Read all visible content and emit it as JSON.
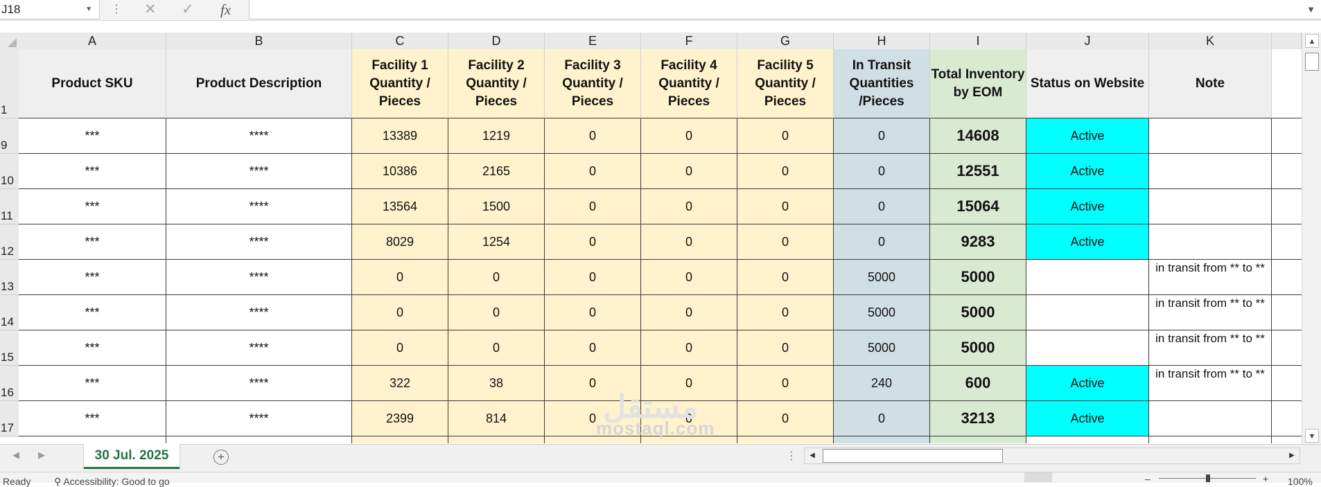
{
  "formula_bar": {
    "name_box": "J18",
    "cancel_icon": "✕",
    "enter_icon": "✓",
    "fx_label": "fx",
    "formula_value": ""
  },
  "columns": [
    "A",
    "B",
    "C",
    "D",
    "E",
    "F",
    "G",
    "H",
    "I",
    "J",
    "K"
  ],
  "header_row": {
    "row_number": "1",
    "cells": [
      "Product SKU",
      "Product Description",
      "Facility 1 Quantity / Pieces",
      "Facility 2 Quantity / Pieces",
      "Facility 3 Quantity / Pieces",
      "Facility 4 Quantity / Pieces",
      "Facility 5 Quantity / Pieces",
      "In Transit Quantities /Pieces",
      "Total Inventory by EOM",
      "Status on Website",
      "Note"
    ]
  },
  "rows": [
    {
      "row": "9",
      "cells": [
        "***",
        "****",
        "13389",
        "1219",
        "0",
        "0",
        "0",
        "0",
        "14608",
        "Active",
        ""
      ]
    },
    {
      "row": "10",
      "cells": [
        "***",
        "****",
        "10386",
        "2165",
        "0",
        "0",
        "0",
        "0",
        "12551",
        "Active",
        ""
      ]
    },
    {
      "row": "11",
      "cells": [
        "***",
        "****",
        "13564",
        "1500",
        "0",
        "0",
        "0",
        "0",
        "15064",
        "Active",
        ""
      ]
    },
    {
      "row": "12",
      "cells": [
        "***",
        "****",
        "8029",
        "1254",
        "0",
        "0",
        "0",
        "0",
        "9283",
        "Active",
        ""
      ]
    },
    {
      "row": "13",
      "cells": [
        "***",
        "****",
        "0",
        "0",
        "0",
        "0",
        "0",
        "5000",
        "5000",
        "",
        "in transit from ** to **"
      ]
    },
    {
      "row": "14",
      "cells": [
        "***",
        "****",
        "0",
        "0",
        "0",
        "0",
        "0",
        "5000",
        "5000",
        "",
        "in transit from ** to **"
      ]
    },
    {
      "row": "15",
      "cells": [
        "***",
        "****",
        "0",
        "0",
        "0",
        "0",
        "0",
        "5000",
        "5000",
        "",
        "in transit from ** to **"
      ]
    },
    {
      "row": "16",
      "cells": [
        "***",
        "****",
        "322",
        "38",
        "0",
        "0",
        "0",
        "240",
        "600",
        "Active",
        "in transit from ** to **"
      ]
    },
    {
      "row": "17",
      "cells": [
        "***",
        "****",
        "2399",
        "814",
        "0",
        "0",
        "0",
        "0",
        "3213",
        "Active",
        ""
      ]
    }
  ],
  "colors": {
    "facility_fill": "#fff2cc",
    "transit_fill": "#d0dfe3",
    "total_fill": "#d9ead3",
    "status_active_fill": "#00ffff",
    "header_gray_fill": "#efefef",
    "sheet_tab_green": "#217346"
  },
  "sheet_tabs": [
    {
      "label": "30 Jul. 2025",
      "active": true
    }
  ],
  "add_sheet_icon": "+",
  "watermark": {
    "arabic": "مستقل",
    "latin": "mostaql.com"
  },
  "status_bar": {
    "ready": "Ready",
    "accessibility": "Accessibility: Good to go",
    "zoom": "100%"
  }
}
